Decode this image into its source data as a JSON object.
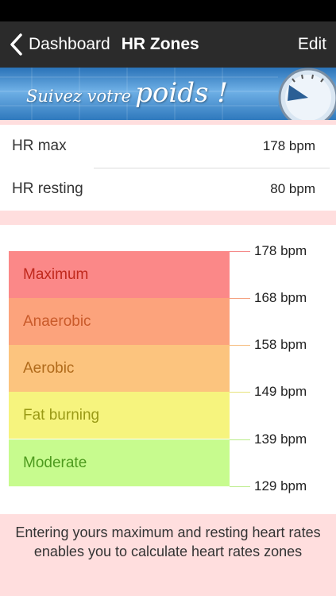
{
  "nav": {
    "back_label": "Dashboard",
    "title": "HR Zones",
    "edit_label": "Edit"
  },
  "banner": {
    "text_small": "Suivez votre",
    "text_big": "poids !"
  },
  "settings": {
    "hr_max": {
      "label": "HR max",
      "value": "178 bpm"
    },
    "hr_resting": {
      "label": "HR resting",
      "value": "80 bpm"
    }
  },
  "zones": [
    {
      "name": "Maximum",
      "color": "#fb8888",
      "text_color": "#c0291d",
      "tick_color": "#f58a8a"
    },
    {
      "name": "Anaerobic",
      "color": "#fca37c",
      "text_color": "#c95a2a",
      "tick_color": "#f59f7d"
    },
    {
      "name": "Aerobic",
      "color": "#fcc47e",
      "text_color": "#b06a1a",
      "tick_color": "#f6bb7c"
    },
    {
      "name": "Fat burning",
      "color": "#f6f47e",
      "text_color": "#9a9a16",
      "tick_color": "#e7e37a"
    },
    {
      "name": "Moderate",
      "color": "#c7fb8e",
      "text_color": "#4d9a1e",
      "tick_color": "#b8ec86"
    }
  ],
  "thresholds": [
    "178 bpm",
    "168 bpm",
    "158 bpm",
    "149 bpm",
    "139 bpm",
    "129 bpm"
  ],
  "footer_text": "Entering yours maximum and resting heart rates enables you to calculate heart rates zones"
}
